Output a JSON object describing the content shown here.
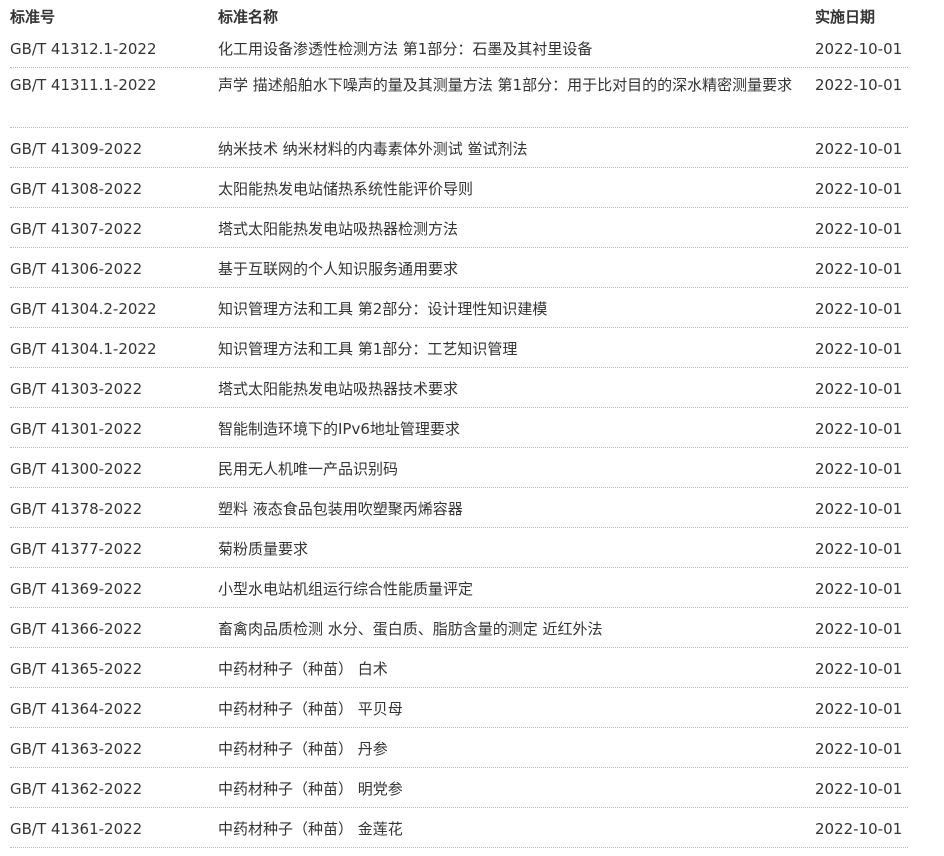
{
  "table": {
    "headers": {
      "code": "标准号",
      "name": "标准名称",
      "date": "实施日期"
    },
    "rows": [
      {
        "code": "GB/T 41312.1-2022",
        "name": "化工用设备渗透性检测方法 第1部分：石墨及其衬里设备",
        "date": "2022-10-01"
      },
      {
        "code": "GB/T 41311.1-2022",
        "name": "声学 描述船舶水下噪声的量及其测量方法 第1部分：用于比对目的的深水精密测量要求",
        "date": "2022-10-01"
      },
      {
        "code": "GB/T 41309-2022",
        "name": "纳米技术 纳米材料的内毒素体外测试 鲎试剂法",
        "date": "2022-10-01"
      },
      {
        "code": "GB/T 41308-2022",
        "name": "太阳能热发电站储热系统性能评价导则",
        "date": "2022-10-01"
      },
      {
        "code": "GB/T 41307-2022",
        "name": "塔式太阳能热发电站吸热器检测方法",
        "date": "2022-10-01"
      },
      {
        "code": "GB/T 41306-2022",
        "name": "基于互联网的个人知识服务通用要求",
        "date": "2022-10-01"
      },
      {
        "code": "GB/T 41304.2-2022",
        "name": "知识管理方法和工具 第2部分：设计理性知识建模",
        "date": "2022-10-01"
      },
      {
        "code": "GB/T 41304.1-2022",
        "name": "知识管理方法和工具 第1部分：工艺知识管理",
        "date": "2022-10-01"
      },
      {
        "code": "GB/T 41303-2022",
        "name": "塔式太阳能热发电站吸热器技术要求",
        "date": "2022-10-01"
      },
      {
        "code": "GB/T 41301-2022",
        "name": "智能制造环境下的IPv6地址管理要求",
        "date": "2022-10-01"
      },
      {
        "code": "GB/T 41300-2022",
        "name": "民用无人机唯一产品识别码",
        "date": "2022-10-01"
      },
      {
        "code": "GB/T 41378-2022",
        "name": "塑料 液态食品包装用吹塑聚丙烯容器",
        "date": "2022-10-01"
      },
      {
        "code": "GB/T 41377-2022",
        "name": "菊粉质量要求",
        "date": "2022-10-01"
      },
      {
        "code": "GB/T 41369-2022",
        "name": "小型水电站机组运行综合性能质量评定",
        "date": "2022-10-01"
      },
      {
        "code": "GB/T 41366-2022",
        "name": "畜禽肉品质检测 水分、蛋白质、脂肪含量的测定 近红外法",
        "date": "2022-10-01"
      },
      {
        "code": "GB/T 41365-2022",
        "name": "中药材种子（种苗） 白术",
        "date": "2022-10-01"
      },
      {
        "code": "GB/T 41364-2022",
        "name": "中药材种子（种苗） 平贝母",
        "date": "2022-10-01"
      },
      {
        "code": "GB/T 41363-2022",
        "name": "中药材种子（种苗） 丹参",
        "date": "2022-10-01"
      },
      {
        "code": "GB/T 41362-2022",
        "name": "中药材种子（种苗） 明党参",
        "date": "2022-10-01"
      },
      {
        "code": "GB/T 41361-2022",
        "name": "中药材种子（种苗） 金莲花",
        "date": "2022-10-01"
      }
    ]
  }
}
